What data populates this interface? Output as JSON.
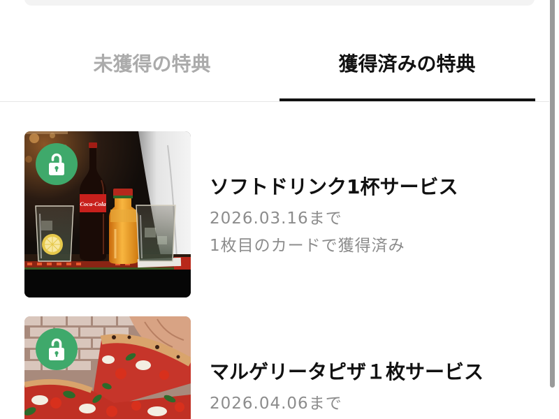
{
  "tabs": [
    {
      "label": "未獲得の特典",
      "active": false
    },
    {
      "label": "獲得済みの特典",
      "active": true
    }
  ],
  "rewards": [
    {
      "title": "ソフトドリンク1杯サービス",
      "expiry": "2026.03.16まで",
      "note": "1枚目のカードで獲得済み",
      "badge_icon": "unlock-icon",
      "image_logo_text": "Coca-Cola"
    },
    {
      "title": "マルゲリータピザ１枚サービス",
      "expiry": "2026.04.06まで",
      "badge_icon": "unlock-icon"
    }
  ],
  "colors": {
    "accent": "#3fa96b",
    "text_primary": "#111111",
    "text_secondary": "#8c8c8c",
    "tab_inactive": "#ababab",
    "tab_indicator": "#111111"
  }
}
